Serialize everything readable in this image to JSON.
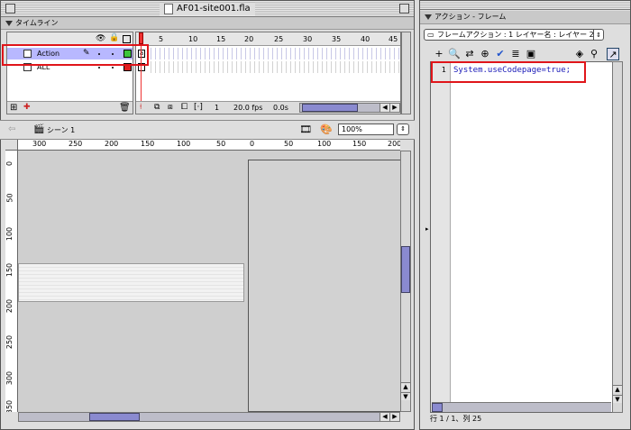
{
  "document_window": {
    "title": "AF01-site001.fla"
  },
  "timeline": {
    "panel_title": "タイムライン",
    "layers": [
      {
        "name": "Action",
        "selected": true,
        "color": "#3cc43c"
      },
      {
        "name": "ALL",
        "selected": false,
        "color": "#e02020"
      }
    ],
    "frame_numbers": [
      "5",
      "10",
      "15",
      "20",
      "25",
      "30",
      "35",
      "40",
      "45"
    ],
    "current_frame": "1",
    "frame_rate": "20.0 fps",
    "elapsed": "0.0s"
  },
  "scene": {
    "name": "シーン 1",
    "zoom": "100%"
  },
  "rulers": {
    "top": [
      "300",
      "250",
      "200",
      "150",
      "100",
      "50",
      "0",
      "50",
      "100",
      "150",
      "200"
    ],
    "left": [
      "0",
      "50",
      "100",
      "150",
      "200",
      "250",
      "300",
      "350"
    ]
  },
  "actions_window": {
    "title": "アクション - フレーム",
    "selector": "フレームアクション : 1 レイヤー名 : レイヤー 2",
    "code_lines": [
      {
        "number": "1",
        "text": "System.useCodepage=true;"
      }
    ],
    "status": "行 1 / 1、列 25"
  },
  "colors": {
    "highlight": "#e0151a",
    "selected_layer": "#b8b8ff",
    "scroll_thumb": "#8a8ad0",
    "code_text": "#1a1ab8"
  }
}
